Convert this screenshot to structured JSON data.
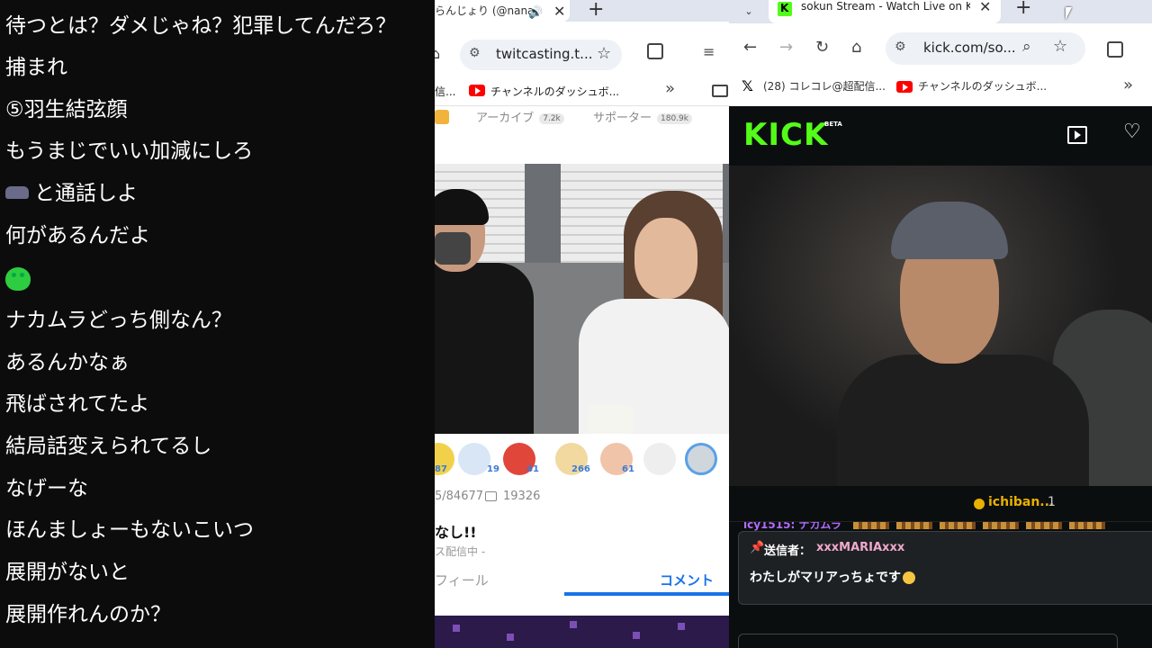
{
  "comments": [
    {
      "text": "待つとは？ダメじゃね？犯罪してんだろ？",
      "emote": null
    },
    {
      "text": "捕まれ",
      "emote": null
    },
    {
      "text": "⑤羽生結弦顔",
      "emote": null
    },
    {
      "text": "もうまじでいい加減にしろ",
      "emote": null
    },
    {
      "text": "と通話しよ",
      "emote": "hippo-emote"
    },
    {
      "text": "何があるんだよ",
      "emote": null
    },
    {
      "text": "",
      "emote": "frog-emote"
    },
    {
      "text": "ナカムラどっち側なん？",
      "emote": null
    },
    {
      "text": "あるんかなぁ",
      "emote": null
    },
    {
      "text": "飛ばされてたよ",
      "emote": null
    },
    {
      "text": "結局話変えられてるし",
      "emote": null
    },
    {
      "text": "なげーな",
      "emote": null
    },
    {
      "text": "ほんましょーもないこいつ",
      "emote": null
    },
    {
      "text": "展開がないと",
      "emote": null
    },
    {
      "text": "展開作れんのか？",
      "emote": null
    }
  ],
  "twitcasting": {
    "tab_title": "らんじょり (@nana",
    "url": "twitcasting.t...",
    "bookmark_cut": "信...",
    "bookmark_youtube": "チャンネルのダッシュボ...",
    "archive_label": "アーカイブ",
    "archive_count": "7.2k",
    "supporter_label": "サポーター",
    "supporter_count": "180.9k",
    "gifts": [
      {
        "count": "87",
        "color": "#f2d14a"
      },
      {
        "count": "19",
        "color": "#d8e6f5"
      },
      {
        "count": "41",
        "color": "#e0463a"
      },
      {
        "count": "266",
        "color": "#f1d9a0"
      },
      {
        "count": "61",
        "color": "#f0c4a8"
      },
      {
        "count": "",
        "color": "#eeeeee"
      },
      {
        "count": "",
        "color": "#cfd6dc"
      }
    ],
    "views": "5/84677",
    "comment_count": "19326",
    "title": "なし!!",
    "subtitle": "ス配信中 -",
    "tab_profile": "フィール",
    "tab_comment": "コメント"
  },
  "kick": {
    "tab_title": "sokun Stream - Watch Live on K",
    "url": "kick.com/so...",
    "bookmark_x": "(28) コレコレ@超配信...",
    "bookmark_youtube": "チャンネルのダッシュボ...",
    "logo": "KICK",
    "beta": "BETA",
    "info_user": "ichiban...",
    "info_count": "1",
    "chat_strip_name": "icy1515: ナカムラ",
    "pinned_label": "送信者：",
    "pinned_sender": "xxxMARIAxxx",
    "pinned_message": "わたしがマリアっちょです"
  },
  "colors": {
    "kick_green": "#53fc18",
    "accent_blue": "#1a73e8",
    "pinned_sender": "#f0a8cc"
  }
}
